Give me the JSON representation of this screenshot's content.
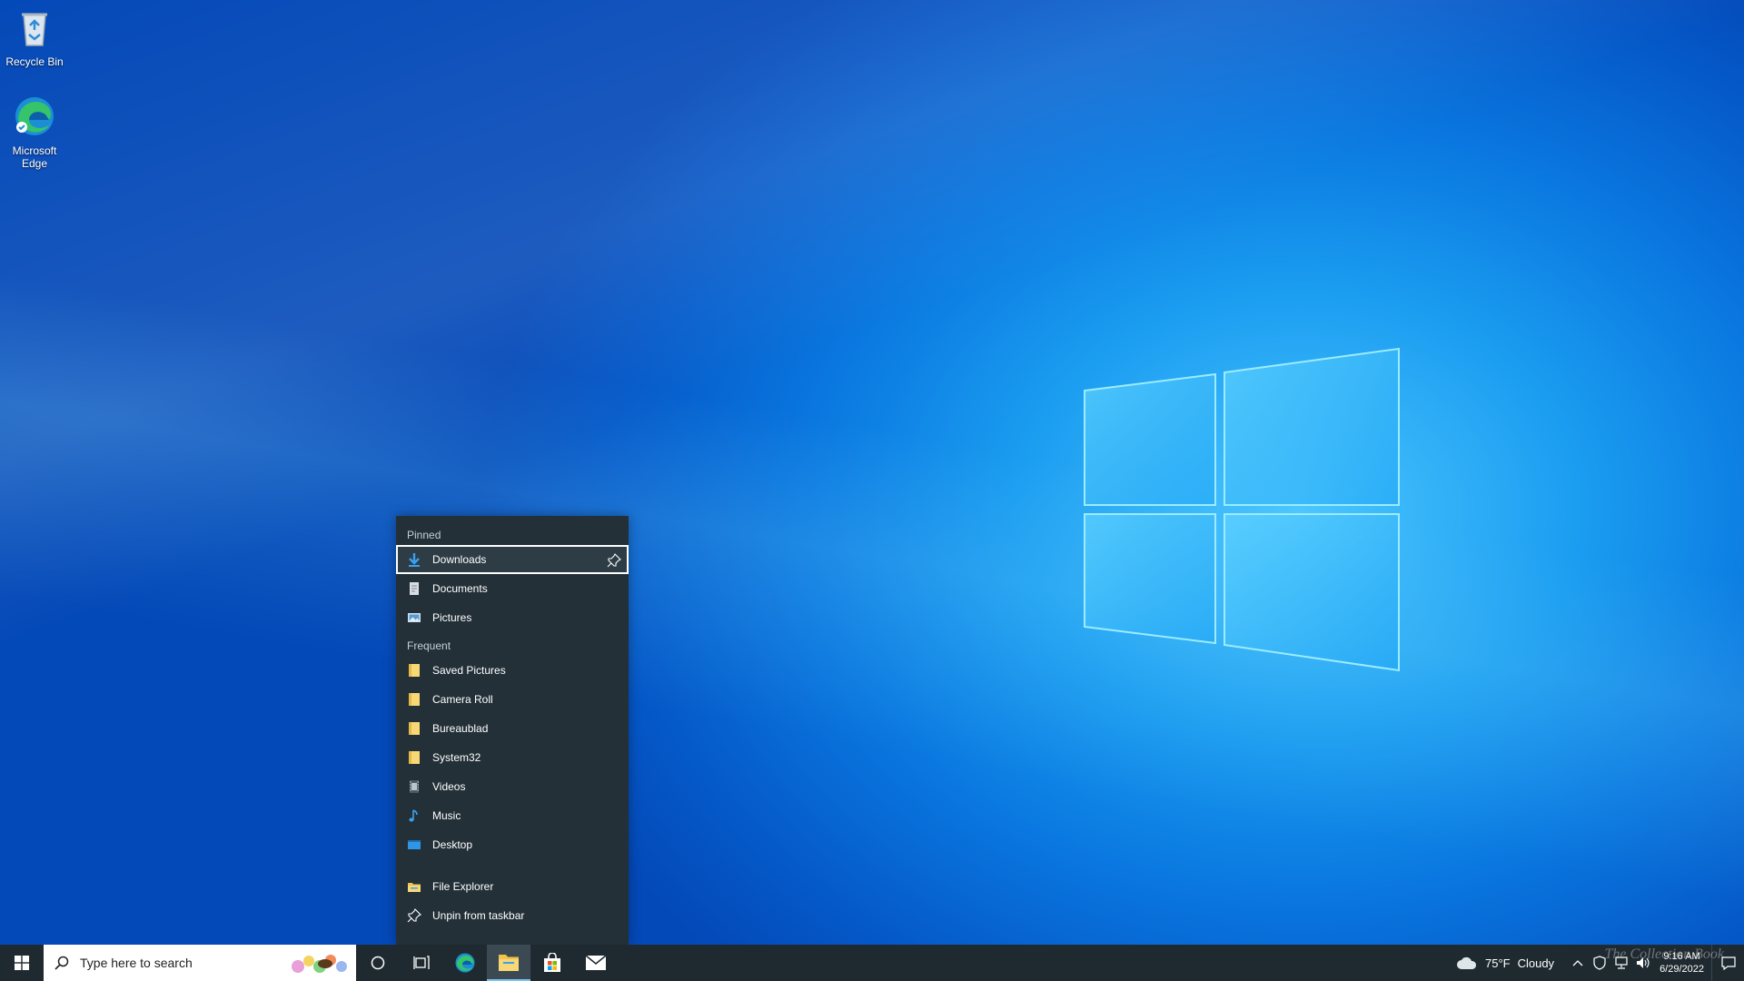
{
  "desktop": {
    "icons": [
      {
        "label": "Recycle Bin",
        "icon": "recycle-bin-icon"
      },
      {
        "label": "Microsoft Edge",
        "icon": "edge-icon"
      }
    ]
  },
  "jumplist": {
    "pinned_header": "Pinned",
    "pinned": [
      {
        "label": "Downloads",
        "icon": "download-arrow-icon",
        "selected": true
      },
      {
        "label": "Documents",
        "icon": "document-icon"
      },
      {
        "label": "Pictures",
        "icon": "picture-icon"
      }
    ],
    "frequent_header": "Frequent",
    "frequent": [
      {
        "label": "Saved Pictures",
        "icon": "folder-icon"
      },
      {
        "label": "Camera Roll",
        "icon": "folder-icon"
      },
      {
        "label": "Bureaublad",
        "icon": "folder-icon"
      },
      {
        "label": "System32",
        "icon": "folder-icon"
      },
      {
        "label": "Videos",
        "icon": "video-icon"
      },
      {
        "label": "Music",
        "icon": "music-note-icon"
      },
      {
        "label": "Desktop",
        "icon": "desktop-icon"
      }
    ],
    "tasks": [
      {
        "label": "File Explorer",
        "icon": "file-explorer-icon"
      },
      {
        "label": "Unpin from taskbar",
        "icon": "unpin-icon"
      }
    ]
  },
  "taskbar": {
    "search_placeholder": "Type here to search",
    "apps": [
      "cortana-icon",
      "task-view-icon",
      "edge-icon",
      "file-explorer-icon",
      "store-icon",
      "mail-icon"
    ],
    "active_app": "file-explorer-icon"
  },
  "tray": {
    "temperature": "75°F",
    "condition": "Cloudy",
    "time": "9:16 AM",
    "date": "6/29/2022"
  },
  "watermark": "The Collection Book",
  "colors": {
    "jumplist_bg": "#233038",
    "taskbar_bg": "#1f2a30",
    "accent": "#7cc4f4",
    "folder_yellow": "#f8d775"
  }
}
